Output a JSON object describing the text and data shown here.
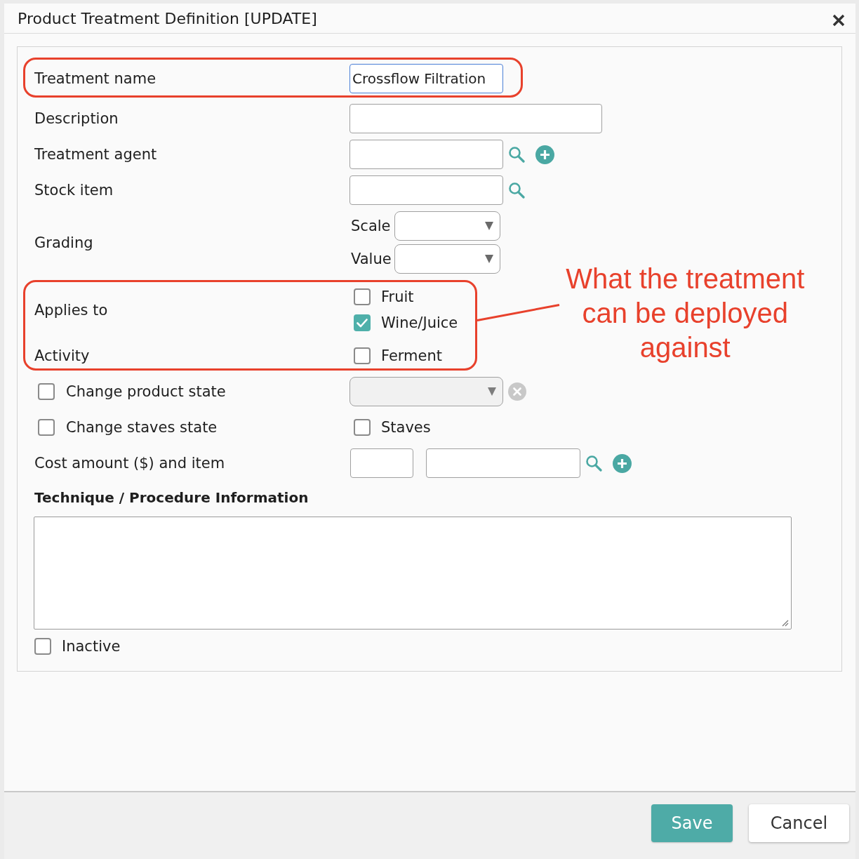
{
  "window": {
    "title": "Product Treatment Definition [UPDATE]"
  },
  "form": {
    "rows": [
      {
        "kind": "group",
        "highlighted": true,
        "rows": [
          {
            "kind": "input",
            "label": "Treatment name",
            "value": "Crossflow Filtration",
            "focused": true
          }
        ]
      },
      {
        "kind": "wide_input",
        "label": "Description",
        "focused": false
      },
      {
        "kind": "input",
        "label": "Treatment agent",
        "focused": false,
        "searchable": true,
        "addable": true
      },
      {
        "kind": "input",
        "label": "Stock item",
        "focused": false,
        "searchable": true
      },
      {
        "kind": "grading",
        "label": "Grading",
        "selects": [
          {
            "label": "Scale"
          },
          {
            "label": "Value"
          }
        ]
      },
      {
        "kind": "group",
        "highlighted": true,
        "callout": "What the treatment can be deployed against",
        "rows": [
          {
            "kind": "checklist",
            "label": "Applies to",
            "options": [
              {
                "label": "Fruit",
                "checked": false
              },
              {
                "label": "Wine/Juice",
                "checked": true
              }
            ]
          },
          {
            "kind": "checklist",
            "label": "Activity",
            "options": [
              {
                "label": "Ferment",
                "checked": false
              }
            ]
          }
        ]
      },
      {
        "kind": "toggle_select",
        "label": "Change product state",
        "checked": false,
        "disabled": true,
        "clearable": true
      },
      {
        "kind": "toggle_check",
        "label": "Change staves state",
        "checked": false,
        "option": {
          "label": "Staves",
          "checked": false
        }
      },
      {
        "kind": "cost",
        "label": "Cost amount ($) and item",
        "searchable": true,
        "addable": true
      }
    ],
    "technique": {
      "heading": "Technique / Procedure Information"
    },
    "inactive": {
      "label": "Inactive",
      "checked": false
    }
  },
  "buttons": [
    {
      "kind": "primary",
      "label": "Save"
    },
    {
      "kind": "secondary",
      "label": "Cancel"
    }
  ]
}
